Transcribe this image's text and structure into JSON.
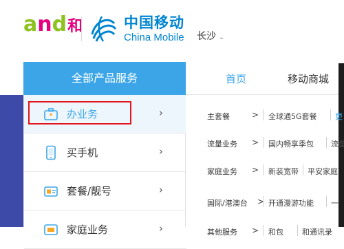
{
  "brand": {
    "and_logo": [
      "a",
      "n",
      "d",
      "和"
    ],
    "cm_name_cn": "中国移动",
    "cm_name_en": "China Mobile"
  },
  "city": {
    "name": "长沙",
    "chevron": "⌄"
  },
  "category_header": "全部产品服务",
  "top_nav": {
    "home": "首页",
    "mall": "移动商城"
  },
  "side_menu": [
    {
      "label": "办业务",
      "icon": "briefcase-icon",
      "arrow": "›"
    },
    {
      "label": "买手机",
      "icon": "phone-icon",
      "arrow": "›"
    },
    {
      "label": "套餐/靓号",
      "icon": "sim-card-icon",
      "arrow": "›"
    },
    {
      "label": "家庭业务",
      "icon": "home-icon",
      "arrow": "›"
    }
  ],
  "subcategories": [
    {
      "category": "主套餐",
      "gt": ">",
      "links": [
        "全球通5G套餐",
        "更"
      ]
    },
    {
      "category": "流量业务",
      "gt": ">",
      "links": [
        "国内畅享季包",
        "流量"
      ]
    },
    {
      "category": "家庭业务",
      "gt": ">",
      "links": [
        "新装宽带",
        "平安家庭"
      ]
    },
    {
      "category": "国际/港澳台",
      "gt": ">",
      "links": [
        "开通漫游功能",
        "一"
      ]
    },
    {
      "category": "其他服务",
      "gt": ">",
      "links": [
        "和包",
        "和通讯录"
      ]
    }
  ],
  "colors": {
    "accent_blue": "#3ba5e8",
    "brand_blue": "#0085d0",
    "left_band": "#3e4aa8",
    "highlight_red": "#e1141c"
  }
}
